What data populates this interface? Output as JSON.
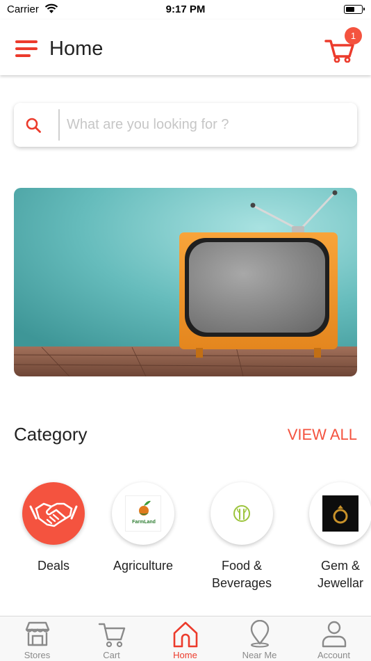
{
  "status_bar": {
    "carrier": "Carrier",
    "time": "9:17 PM",
    "battery_level": 0.55
  },
  "header": {
    "title": "Home",
    "cart_count": "1"
  },
  "search": {
    "placeholder": "What are you looking for ?"
  },
  "category": {
    "title": "Category",
    "view_all": "VIEW ALL",
    "items": [
      {
        "label": "Deals",
        "icon": "handshake-icon"
      },
      {
        "label": "Agriculture",
        "icon": "farmland-logo",
        "logo_text": "FarmLand"
      },
      {
        "label_line1": "Food &",
        "label_line2": "Beverages",
        "icon": "leaf-logo"
      },
      {
        "label_line1": "Gem &",
        "label_line2": "Jewellar",
        "icon": "ring-logo"
      }
    ]
  },
  "tabs": [
    {
      "label": "Stores",
      "icon": "store-icon"
    },
    {
      "label": "Cart",
      "icon": "cart-icon"
    },
    {
      "label": "Home",
      "icon": "home-icon",
      "active": true
    },
    {
      "label": "Near Me",
      "icon": "location-pin-icon"
    },
    {
      "label": "Account",
      "icon": "user-icon"
    }
  ],
  "colors": {
    "accent": "#ec3b2c",
    "badge": "#f4533f",
    "deals_circle": "#f4533f",
    "tab_inactive": "#8a8a8a"
  }
}
